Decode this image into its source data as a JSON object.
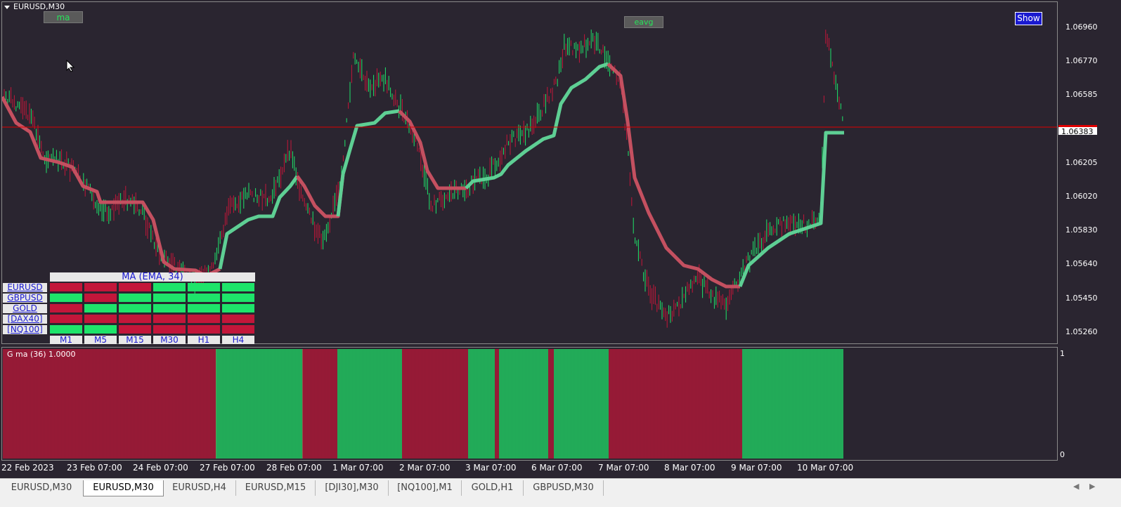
{
  "window": {
    "symbol_title": "EURUSD,M30",
    "colors": {
      "background": "#2a2530",
      "bull": "#1ee46a",
      "bear": "#c3163a",
      "ma_up": "#5ecf94",
      "ma_down": "#c45060",
      "price_line": "#e00000"
    }
  },
  "buttons": {
    "ma": "ma",
    "eavg": "eavg",
    "show": "Show"
  },
  "price_axis": {
    "labels": [
      "1.06960",
      "1.06770",
      "1.06585",
      "1.06205",
      "1.06020",
      "1.05830",
      "1.05640",
      "1.05450",
      "1.05260"
    ],
    "current_price": "1.06383"
  },
  "indicator": {
    "title": "G ma (36) 1.0000",
    "scale_max": "1",
    "scale_min": "0"
  },
  "time_axis": [
    "22 Feb 2023",
    "23 Feb 07:00",
    "24 Feb 07:00",
    "27 Feb 07:00",
    "28 Feb 07:00",
    "1 Mar 07:00",
    "2 Mar 07:00",
    "3 Mar 07:00",
    "6 Mar 07:00",
    "7 Mar 07:00",
    "8 Mar 07:00",
    "9 Mar 07:00",
    "10 Mar 07:00"
  ],
  "ma_grid": {
    "title": "MA (EMA, 34)",
    "columns": [
      "M1",
      "M5",
      "M15",
      "M30",
      "H1",
      "H4"
    ],
    "rows": [
      {
        "symbol": "EURUSD",
        "states": [
          "red",
          "red",
          "red",
          "green",
          "green",
          "green"
        ]
      },
      {
        "symbol": "GBPUSD",
        "states": [
          "green",
          "red",
          "green",
          "green",
          "green",
          "green"
        ]
      },
      {
        "symbol": "GOLD",
        "states": [
          "red",
          "green",
          "green",
          "green",
          "green",
          "green"
        ]
      },
      {
        "symbol": "[DAX40]",
        "states": [
          "red",
          "red",
          "red",
          "red",
          "red",
          "red"
        ]
      },
      {
        "symbol": "[NQ100]",
        "states": [
          "green",
          "green",
          "red",
          "red",
          "red",
          "red"
        ]
      }
    ]
  },
  "tabs": [
    "EURUSD,M30",
    "EURUSD,M30",
    "EURUSD,H4",
    "EURUSD,M15",
    "[DJI30],M30",
    "[NQ100],M1",
    "GOLD,H1",
    "GBPUSD,M30"
  ],
  "active_tab_index": 1
}
